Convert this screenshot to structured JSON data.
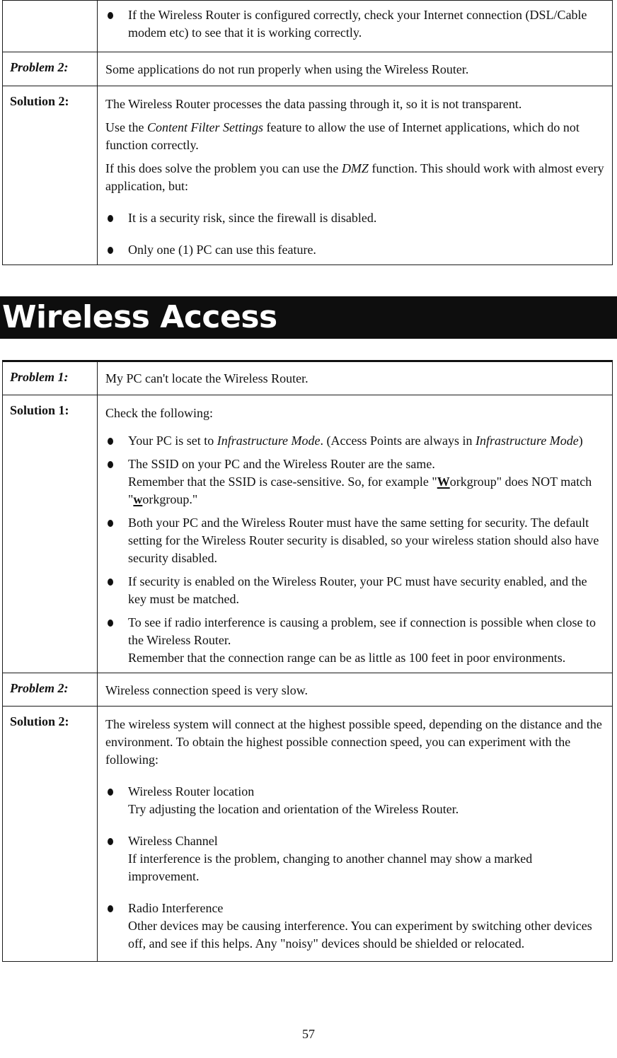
{
  "section1": {
    "continued_bullet": "If the Wireless  Router is configured correctly, check your Internet connection (DSL/Cable modem etc) to see that it is working correctly.",
    "problem2": {
      "label": "Problem 2:",
      "text": "Some applications do not run properly when using the Wireless  Router."
    },
    "solution2": {
      "label": "Solution 2:",
      "para1": "The Wireless  Router processes the data passing through it, so it is not transparent.",
      "para2_pre": "Use the ",
      "para2_em": "Content Filter Settings",
      "para2_post": " feature to allow the use of Internet applications, which do not function correctly.",
      "para3_pre": "If this does solve the problem you can use the ",
      "para3_em": "DMZ",
      "para3_post": " function. This should work with almost every application, but:",
      "bullets": [
        "It is a security risk, since the firewall is disabled.",
        "Only one (1) PC can use this feature."
      ]
    }
  },
  "section2": {
    "heading": "Wireless Access",
    "problem1": {
      "label": "Problem 1:",
      "text": "My PC can't locate the Wireless  Router."
    },
    "solution1": {
      "label": "Solution 1:",
      "intro": "Check the following:",
      "b1_pre": "Your PC is set to ",
      "b1_em1": "Infrastructure Mode",
      "b1_mid": ". (Access Points are always in ",
      "b1_em2": "Infrastructure Mode",
      "b1_post": ")",
      "b2_line1": "The SSID on your PC and the Wireless  Router are the same.",
      "b2_pre": "Remember that the SSID is case-sensitive. So, for example \"",
      "b2_u1": "W",
      "b2_mid": "orkgroup\" does NOT match \"",
      "b2_u2": "w",
      "b2_post": "orkgroup.\"",
      "b3": "Both your PC and the Wireless  Router must have the same setting for security. The default setting for the Wireless  Router security is disabled, so your wireless station should also have security disabled.",
      "b4": "If security is enabled on the Wireless  Router, your PC must have security enabled, and the key must be matched.",
      "b5_line1": "To see if radio interference is causing a problem, see if connection is possible when close to the Wireless  Router.",
      "b5_line2": "Remember that the connection range can be as little as 100 feet in poor environments."
    },
    "problem2": {
      "label": "Problem 2:",
      "text": "Wireless connection speed is very slow."
    },
    "solution2": {
      "label": "Solution 2:",
      "intro": "The wireless system will connect at the highest possible speed, depending on the distance and the environment. To obtain the highest possible connection speed, you can experiment with the following:",
      "items": [
        {
          "title": "Wireless  Router location",
          "desc": "Try adjusting the location and orientation of the Wireless  Router."
        },
        {
          "title": "Wireless Channel",
          "desc": "If interference is the problem, changing to another channel may show a marked improvement."
        },
        {
          "title": "Radio Interference",
          "desc": "Other devices may be causing interference. You can experiment by switching other devices off, and see if this helps. Any \"noisy\" devices should be shielded or relocated."
        }
      ]
    }
  },
  "page_number": "57"
}
